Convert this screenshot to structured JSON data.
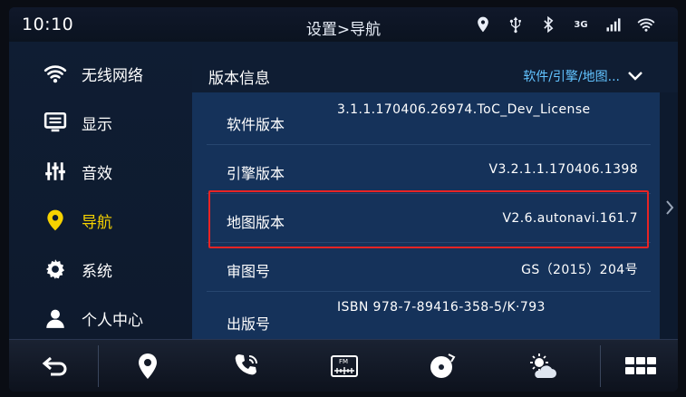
{
  "status_bar": {
    "time": "10:10",
    "title": "设置>导航",
    "network_label": "3G",
    "icons": [
      "location-icon",
      "usb-icon",
      "bluetooth-icon",
      "network-3g-icon",
      "signal-icon",
      "wifi-icon"
    ]
  },
  "sidebar": {
    "items": [
      {
        "label": "无线网络",
        "icon": "wifi-icon",
        "active": false
      },
      {
        "label": "显示",
        "icon": "display-icon",
        "active": false
      },
      {
        "label": "音效",
        "icon": "equalizer-icon",
        "active": false
      },
      {
        "label": "导航",
        "icon": "location-pin-icon",
        "active": true
      },
      {
        "label": "系统",
        "icon": "gear-icon",
        "active": false
      },
      {
        "label": "个人中心",
        "icon": "user-icon",
        "active": false
      }
    ]
  },
  "content": {
    "section_title": "版本信息",
    "dropdown_value": "软件/引擎/地图...",
    "rows": [
      {
        "key": "软件版本",
        "value": "3.1.1.170406.26974.ToC_Dev_License"
      },
      {
        "key": "引擎版本",
        "value": "V3.2.1.1.170406.1398"
      },
      {
        "key": "地图版本",
        "value": "V2.6.autonavi.161.7"
      },
      {
        "key": "审图号",
        "value": "GS（2015）204号"
      },
      {
        "key": "出版号",
        "value": "ISBN 978-7-89416-358-5/K·793"
      }
    ]
  },
  "dock": {
    "buttons": [
      "back-icon",
      "navigation-icon",
      "phone-icon",
      "fm-radio-icon",
      "music-disc-icon",
      "weather-icon",
      "apps-grid-icon"
    ],
    "fm_label": "FM"
  },
  "colors": {
    "active": "#f6d200",
    "accent": "#62c3ff",
    "highlight_border": "#e82424",
    "list_background": "#15325a"
  }
}
